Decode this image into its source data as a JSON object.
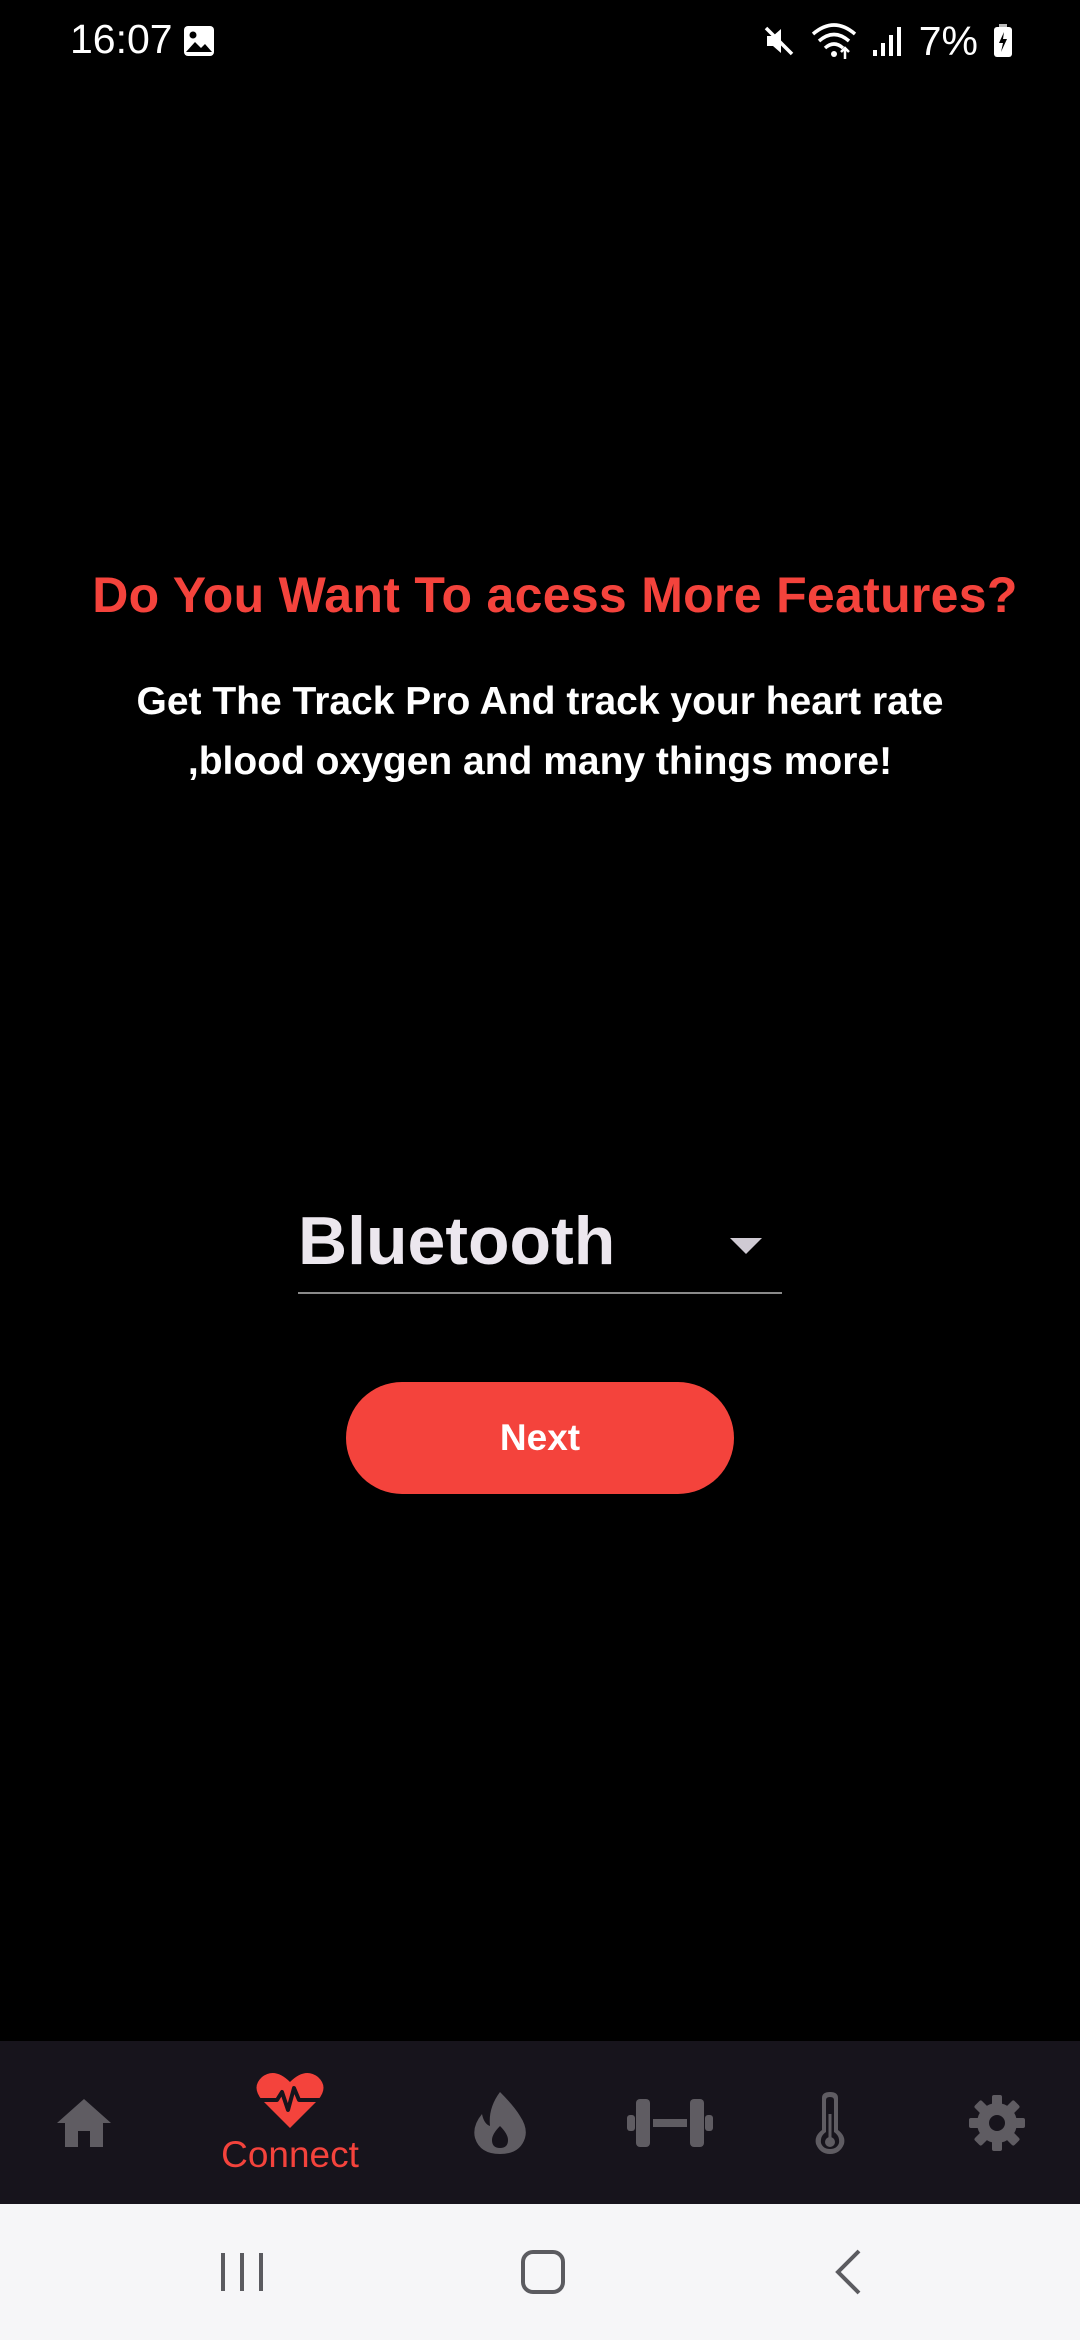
{
  "status_bar": {
    "time": "16:07",
    "battery": "7%",
    "icons": [
      "gallery-icon",
      "mute-icon",
      "wifi-icon",
      "signal-icon",
      "battery-icon"
    ]
  },
  "main": {
    "headline": "Do You Want To acess More Features?",
    "subtext": "Get The Track Pro And track your heart rate ,blood oxygen and many things more!",
    "dropdown": {
      "selected": "Bluetooth"
    },
    "next_button": "Next"
  },
  "bottom_nav": {
    "items": [
      {
        "icon": "home-icon"
      },
      {
        "icon": "heart-rate-icon",
        "label": "Connect",
        "active": true
      },
      {
        "icon": "flame-icon"
      },
      {
        "icon": "dumbbell-icon"
      },
      {
        "icon": "thermometer-icon"
      },
      {
        "icon": "gear-icon"
      }
    ]
  },
  "colors": {
    "accent": "#f4433c",
    "background": "#000000",
    "nav_background": "#17141c",
    "nav_icon_inactive": "#5f5c62"
  }
}
